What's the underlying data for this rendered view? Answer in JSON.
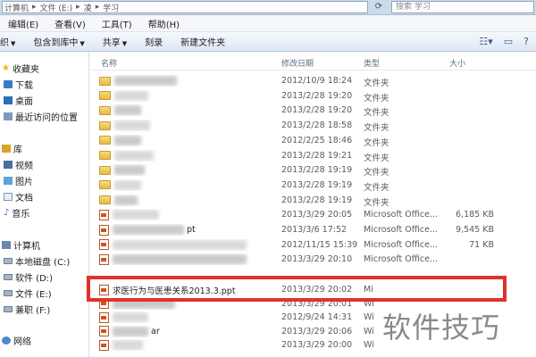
{
  "address": {
    "crumbs": [
      "计算机",
      "文件 (E:)",
      "凌",
      "学习"
    ],
    "search_placeholder": "搜索 学习"
  },
  "menu": [
    "编辑(E)",
    "查看(V)",
    "工具(T)",
    "帮助(H)"
  ],
  "toolbar": {
    "organize": "织",
    "include": "包含到库中",
    "share": "共享",
    "burn": "刻录",
    "new_folder": "新建文件夹"
  },
  "nav": {
    "favorites": "收藏夹",
    "downloads": "下载",
    "desktop": "桌面",
    "recent": "最近访问的位置",
    "library": "库",
    "videos": "视频",
    "pictures": "图片",
    "documents": "文档",
    "music": "音乐",
    "computer": "计算机",
    "drive_c": "本地磁盘 (C:)",
    "drive_d": "软件 (D:)",
    "drive_e": "文件 (E:)",
    "drive_f": "兼职 (F:)",
    "network": "网络"
  },
  "columns": {
    "name": "名称",
    "date": "修改日期",
    "type": "类型",
    "size": "大小"
  },
  "files": [
    {
      "name": "",
      "date": "2012/10/9 18:24",
      "type": "文件夹",
      "size": "",
      "kind": "folder"
    },
    {
      "name": "",
      "date": "2013/2/28 19:20",
      "type": "文件夹",
      "size": "",
      "kind": "folder"
    },
    {
      "name": "",
      "date": "2013/2/28 19:20",
      "type": "文件夹",
      "size": "",
      "kind": "folder"
    },
    {
      "name": "",
      "date": "2013/2/28 18:58",
      "type": "文件夹",
      "size": "",
      "kind": "folder"
    },
    {
      "name": "",
      "date": "2012/2/25 18:46",
      "type": "文件夹",
      "size": "",
      "kind": "folder"
    },
    {
      "name": "",
      "date": "2013/2/28 19:21",
      "type": "文件夹",
      "size": "",
      "kind": "folder"
    },
    {
      "name": "",
      "date": "2013/2/28 19:19",
      "type": "文件夹",
      "size": "",
      "kind": "folder"
    },
    {
      "name": "",
      "date": "2013/2/28 19:19",
      "type": "文件夹",
      "size": "",
      "kind": "folder"
    },
    {
      "name": "",
      "date": "2013/2/28 19:19",
      "type": "文件夹",
      "size": "",
      "kind": "folder"
    },
    {
      "name": "",
      "date": "2013/3/29 20:05",
      "type": "Microsoft Office...",
      "size": "6,185 KB",
      "kind": "ppt"
    },
    {
      "name": "pt",
      "date": "2013/3/6 17:52",
      "type": "Microsoft Office...",
      "size": "9,545 KB",
      "kind": "ppt"
    },
    {
      "name": "",
      "date": "2012/11/15 15:39",
      "type": "Microsoft Office...",
      "size": "71 KB",
      "kind": "doc"
    },
    {
      "name": "",
      "date": "2013/3/29 20:10",
      "type": "Microsoft Office...",
      "size": "",
      "kind": "ppt"
    },
    {
      "name": "求医行为与医患关系2013.3.ppt",
      "date": "2013/3/29 20:02",
      "type": "Mi",
      "size": "",
      "kind": "ppt"
    },
    {
      "name": "",
      "date": "2013/3/29 20:01",
      "type": "Wi",
      "size": "",
      "kind": "ppt"
    },
    {
      "name": "",
      "date": "2012/9/24 14:31",
      "type": "Wi",
      "size": "",
      "kind": "ppt"
    },
    {
      "name": "ar",
      "date": "2013/3/29 20:06",
      "type": "Wi",
      "size": "",
      "kind": "ppt"
    },
    {
      "name": "",
      "date": "2013/3/29 20:00",
      "type": "Wi",
      "size": "",
      "kind": "ppt"
    }
  ],
  "watermark": "软件技巧"
}
